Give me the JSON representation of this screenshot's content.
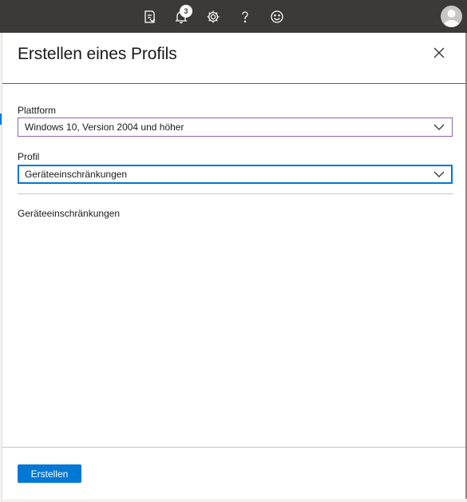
{
  "topbar": {
    "notification_count": "3",
    "icons": [
      "feedback-filter-icon",
      "bell-icon",
      "gear-icon",
      "help-icon",
      "smiley-icon",
      "avatar"
    ]
  },
  "panel": {
    "title": "Erstellen eines Profils",
    "platform": {
      "label": "Plattform",
      "value": "Windows 10, Version 2004 und höher"
    },
    "profile": {
      "label": "Profil",
      "value": "Geräteeinschränkungen"
    },
    "section_text": "Geräteeinschränkungen",
    "create_button": "Erstellen"
  },
  "colors": {
    "topbar_bg": "#3b3a39",
    "accent": "#0078d4",
    "platform_border": "#8764b8"
  }
}
